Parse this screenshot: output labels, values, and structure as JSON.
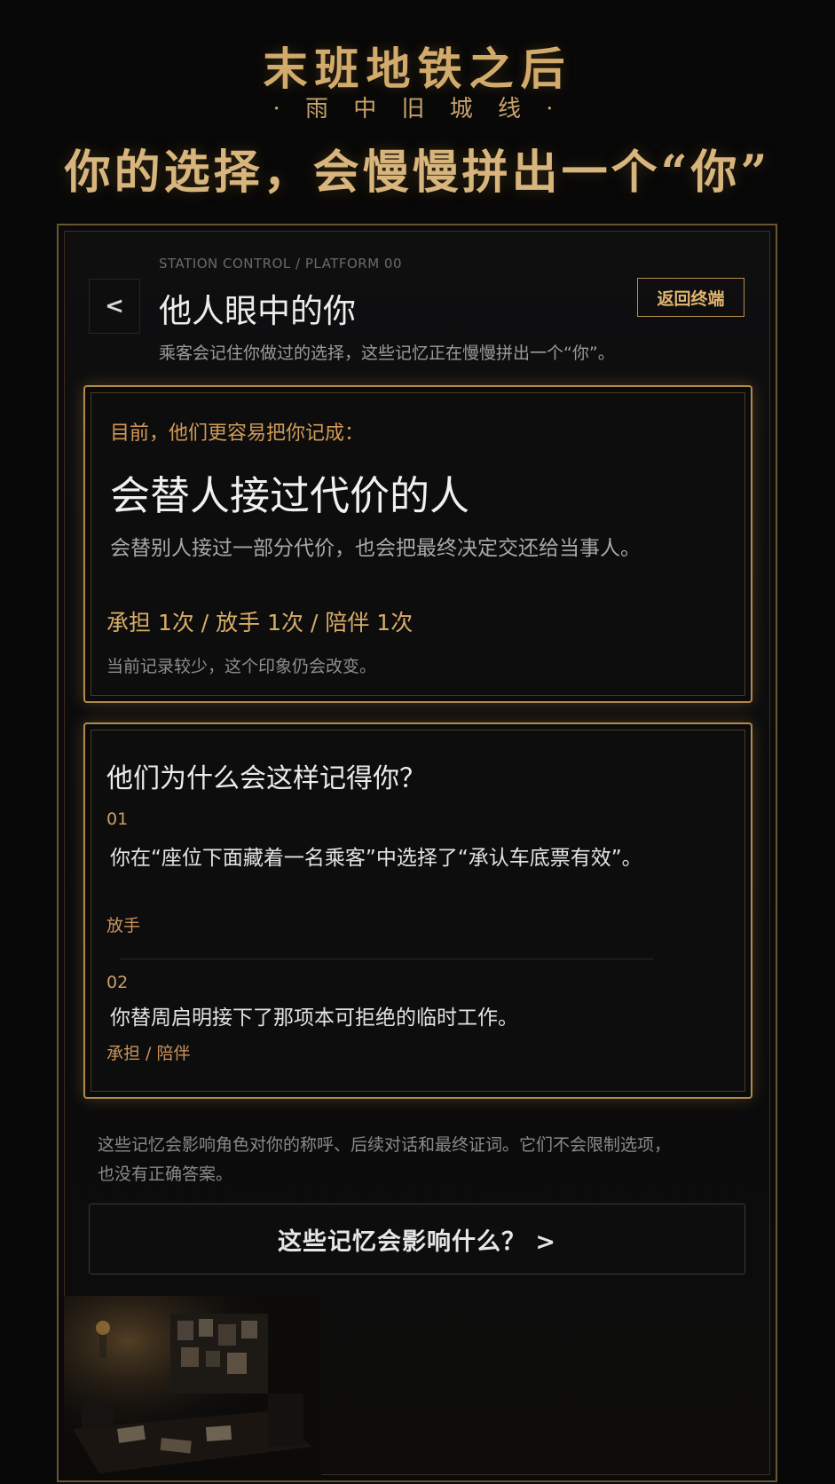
{
  "hero": {
    "title": "末班地铁之后",
    "subtitle": "· 雨 中 旧 城 线 ·",
    "tagline": "你的选择，会慢慢拼出一个“你”"
  },
  "header": {
    "breadcrumb": "STATION CONTROL / PLATFORM 00",
    "back_label": "<",
    "title": "他人眼中的你",
    "terminal_button": "返回终端",
    "description": "乘客会记住你做过的选择，这些记忆正在慢慢拼出一个“你”。"
  },
  "impression": {
    "label": "目前，他们更容易把你记成：",
    "title": "会替人接过代价的人",
    "description": "会替别人接过一部分代价，也会把最终决定交还给当事人。",
    "stats": "承担 1次 / 放手 1次 / 陪伴 1次",
    "note": "当前记录较少，这个印象仍会改变。"
  },
  "reasons": {
    "heading": "他们为什么会这样记得你？",
    "items": [
      {
        "index": "01",
        "text": "你在“座位下面藏着一名乘客”中选择了“承认车底票有效”。",
        "tags": "放手"
      },
      {
        "index": "02",
        "text": "你替周启明接下了那项本可拒绝的临时工作。",
        "tags": "承担 / 陪伴"
      }
    ]
  },
  "footer": {
    "note": "这些记忆会影响角色对你的称呼、后续对话和最终证词。它们不会限制选项，也没有正确答案。",
    "influence_button": "这些记忆会影响什么？ >"
  },
  "colors": {
    "accent_gold": "#d8ac67",
    "background": "#080808"
  },
  "icons": {
    "back": "chevron-left-icon",
    "scene": "room-illustration"
  }
}
